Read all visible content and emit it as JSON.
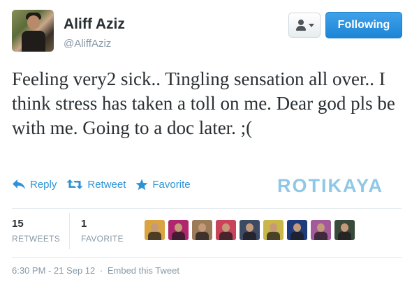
{
  "author": {
    "name": "Aliff Aziz",
    "handle": "@AliffAziz"
  },
  "header": {
    "follow_label": "Following"
  },
  "tweet": {
    "text": "Feeling very2 sick.. Tingling sensation all over.. I think stress has taken a toll on me. Dear god pls be with me. Going to a doc later. ;("
  },
  "actions": {
    "reply_label": "Reply",
    "retweet_label": "Retweet",
    "favorite_label": "Favorite"
  },
  "watermark": "ROTIKAYA",
  "stats": {
    "retweets_count": "15",
    "retweets_label": "RETWEETS",
    "favorites_count": "1",
    "favorites_label": "FAVORITE"
  },
  "faces": [
    {
      "bg": "#d9a441"
    },
    {
      "bg": "#b0266e"
    },
    {
      "bg": "#9c7b5a"
    },
    {
      "bg": "#c9445a"
    },
    {
      "bg": "#3c4a63"
    },
    {
      "bg": "#c9b74a"
    },
    {
      "bg": "#1f3a7a"
    },
    {
      "bg": "#a35a9a"
    },
    {
      "bg": "#3a4a3a"
    }
  ],
  "meta": {
    "timestamp": "6:30 PM - 21 Sep 12",
    "separator": "·",
    "embed_label": "Embed this Tweet"
  },
  "colors": {
    "accent": "#2d93d6",
    "follow_button": "#1d85d6",
    "watermark": "#8fc8e6"
  },
  "icons": [
    "user-menu-icon",
    "reply-icon",
    "retweet-icon",
    "star-icon"
  ]
}
